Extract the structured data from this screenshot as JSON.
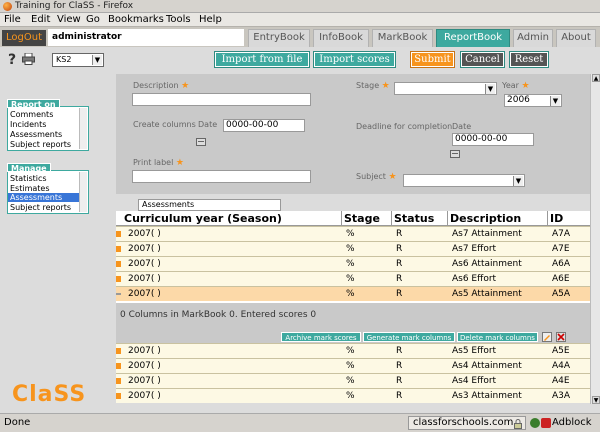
{
  "window": {
    "title": "Training for ClaSS - Firefox"
  },
  "menu": [
    "File",
    "Edit",
    "View",
    "Go",
    "Bookmarks",
    "Tools",
    "Help"
  ],
  "nav": {
    "logout": "LogOut",
    "user": "administrator",
    "tabs": [
      "EntryBook",
      "InfoBook",
      "MarkBook",
      "ReportBook",
      "Admin",
      "About"
    ],
    "active_tab": "ReportBook"
  },
  "toolbar": {
    "stage_value": "KS2",
    "import_file": "Import from file",
    "import_scores": "Import scores",
    "submit": "Submit",
    "cancel": "Cancel",
    "reset": "Reset"
  },
  "sidebar": {
    "report_on": {
      "header": "Report on",
      "items": [
        "Comments",
        "Incidents",
        "Assessments",
        "Subject reports"
      ]
    },
    "manage": {
      "header": "Manage",
      "items": [
        "Statistics",
        "Estimates",
        "Assessments",
        "Subject reports"
      ],
      "selected": "Assessments"
    }
  },
  "form": {
    "description_label": "Description",
    "stage_label": "Stage",
    "year_label": "Year",
    "year_value": "2006",
    "create_columns_label": "Create columns",
    "date_label": "Date",
    "create_date": "0000-00-00",
    "deadline_label": "Deadline for completion",
    "deadline_date": "0000-00-00",
    "print_label": "Print label",
    "subject_label": "Subject",
    "required_mark": "★"
  },
  "assessments_label": "Assessments",
  "grid": {
    "headers": [
      "Curriculum year (Season)",
      "Stage",
      "Status",
      "Description",
      "ID"
    ],
    "rows": [
      [
        "2007( )",
        "%",
        "R",
        "As7 Attainment",
        "A7A"
      ],
      [
        "2007( )",
        "%",
        "R",
        "As7 Effort",
        "A7E"
      ],
      [
        "2007( )",
        "%",
        "R",
        "As6 Attainment",
        "A6A"
      ],
      [
        "2007( )",
        "%",
        "R",
        "As6 Effort",
        "A6E"
      ],
      [
        "2007( )",
        "%",
        "R",
        "As5 Attainment",
        "A5A"
      ]
    ],
    "selected_row": 4
  },
  "midbar": {
    "info": "0 Columns in MarkBook 0. Entered scores 0",
    "archive": "Archive mark scores",
    "generate": "Generate mark columns",
    "delete": "Delete mark columns"
  },
  "grid2": {
    "rows": [
      [
        "2007( )",
        "%",
        "R",
        "As5 Effort",
        "A5E"
      ],
      [
        "2007( )",
        "%",
        "R",
        "As4 Attainment",
        "A4A"
      ],
      [
        "2007( )",
        "%",
        "R",
        "As4 Effort",
        "A4E"
      ],
      [
        "2007( )",
        "%",
        "R",
        "As3 Attainment",
        "A3A"
      ]
    ]
  },
  "logo": "ClaSS",
  "status": {
    "done": "Done",
    "site": "classforschools.com",
    "adblock": "Adblock"
  },
  "colors": {
    "teal": "#3ea99f",
    "orange": "#f7941d",
    "row": "#fdf9e4",
    "row_selected": "#fcd9a8"
  }
}
